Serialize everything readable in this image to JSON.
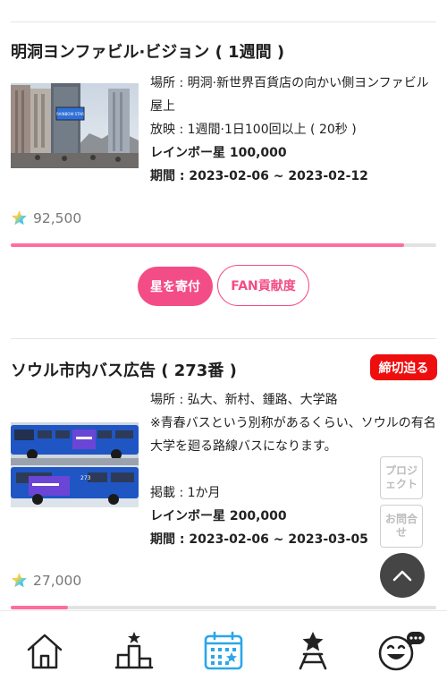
{
  "items": [
    {
      "title": "明洞ヨンファビル·ビジョン ( 1週間 )",
      "location": "場所 : 明洞·新世界百貨店の向かい側ヨンファビル屋上",
      "schedule": "放映 : 1週間·1日100回以上 ( 20秒 )",
      "goal": "レインボー星 100,000",
      "period": "期間 : 2023-02-06 ~ 2023-02-12",
      "stars": "92,500",
      "progress": 0.925,
      "donate_button": "星を寄付",
      "fan_button": "FAN貢献度",
      "billboard_text": "RAINBOW STAR"
    },
    {
      "title": "ソウル市内バス広告 ( 273番 )",
      "badge": "締切迫る",
      "location": "場所 : 弘大、新村、鍾路、大学路",
      "note": "※青春バスという別称があるくらい、ソウルの有名大学を廻る路線バスになります。",
      "schedule": "掲載 : 1か月",
      "goal": "レインボー星 200,000",
      "period": "期間 : 2023-02-06 ~ 2023-03-05",
      "stars": "27,000",
      "progress": 0.135,
      "bus_number": "273"
    }
  ],
  "side_buttons": {
    "project": "プロジェクト",
    "contact": "お問合せ"
  },
  "colors": {
    "accent": "#f34d87",
    "progress": "#ff6d9d",
    "badge": "#ee0e0e",
    "nav_active": "#2aa7e8"
  },
  "nav": [
    {
      "icon": "home-icon",
      "active": false
    },
    {
      "icon": "ranking-icon",
      "active": false
    },
    {
      "icon": "calendar-icon",
      "active": true
    },
    {
      "icon": "star-tower-icon",
      "active": false
    },
    {
      "icon": "chat-smiley-icon",
      "active": false
    }
  ]
}
